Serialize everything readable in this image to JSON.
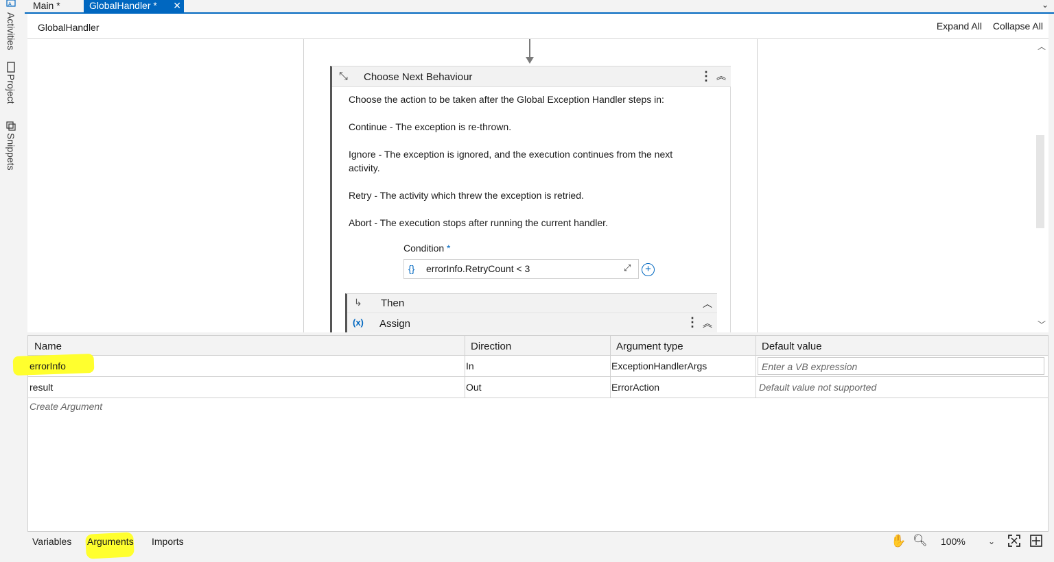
{
  "rail": {
    "activities_label": "Activities",
    "project_label": "Project",
    "snippets_label": "Snippets"
  },
  "tabs": {
    "main_label": "Main *",
    "global_label": "GlobalHandler *"
  },
  "header": {
    "breadcrumb": "GlobalHandler",
    "expand_all": "Expand All",
    "collapse_all": "Collapse All"
  },
  "activity": {
    "title": "Choose Next Behaviour",
    "paragraphs": [
      "Choose the action to be taken after the Global Exception Handler steps in:",
      "Continue - The exception is re-thrown.",
      "Ignore - The exception is ignored, and the execution continues from the next activity.",
      "Retry - The activity which threw the exception is retried.",
      "Abort - The execution stops after running the current handler."
    ],
    "condition_label": "Condition",
    "condition_required": "*",
    "condition_brace": "{}",
    "condition_value": "errorInfo.RetryCount < 3",
    "then_label": "Then",
    "assign_label": "Assign"
  },
  "arguments": {
    "columns": [
      "Name",
      "Direction",
      "Argument type",
      "Default value"
    ],
    "rows": [
      {
        "name": "errorInfo",
        "direction": "In",
        "type": "ExceptionHandlerArgs",
        "default": "Enter a VB expression"
      },
      {
        "name": "result",
        "direction": "Out",
        "type": "ErrorAction",
        "default": "Default value not supported"
      }
    ],
    "create_hint": "Create Argument"
  },
  "bottom": {
    "variables": "Variables",
    "arguments": "Arguments",
    "imports": "Imports",
    "zoom": "100%"
  },
  "colors": {
    "accent": "#0067c0",
    "highlight": "#ffff2e"
  }
}
